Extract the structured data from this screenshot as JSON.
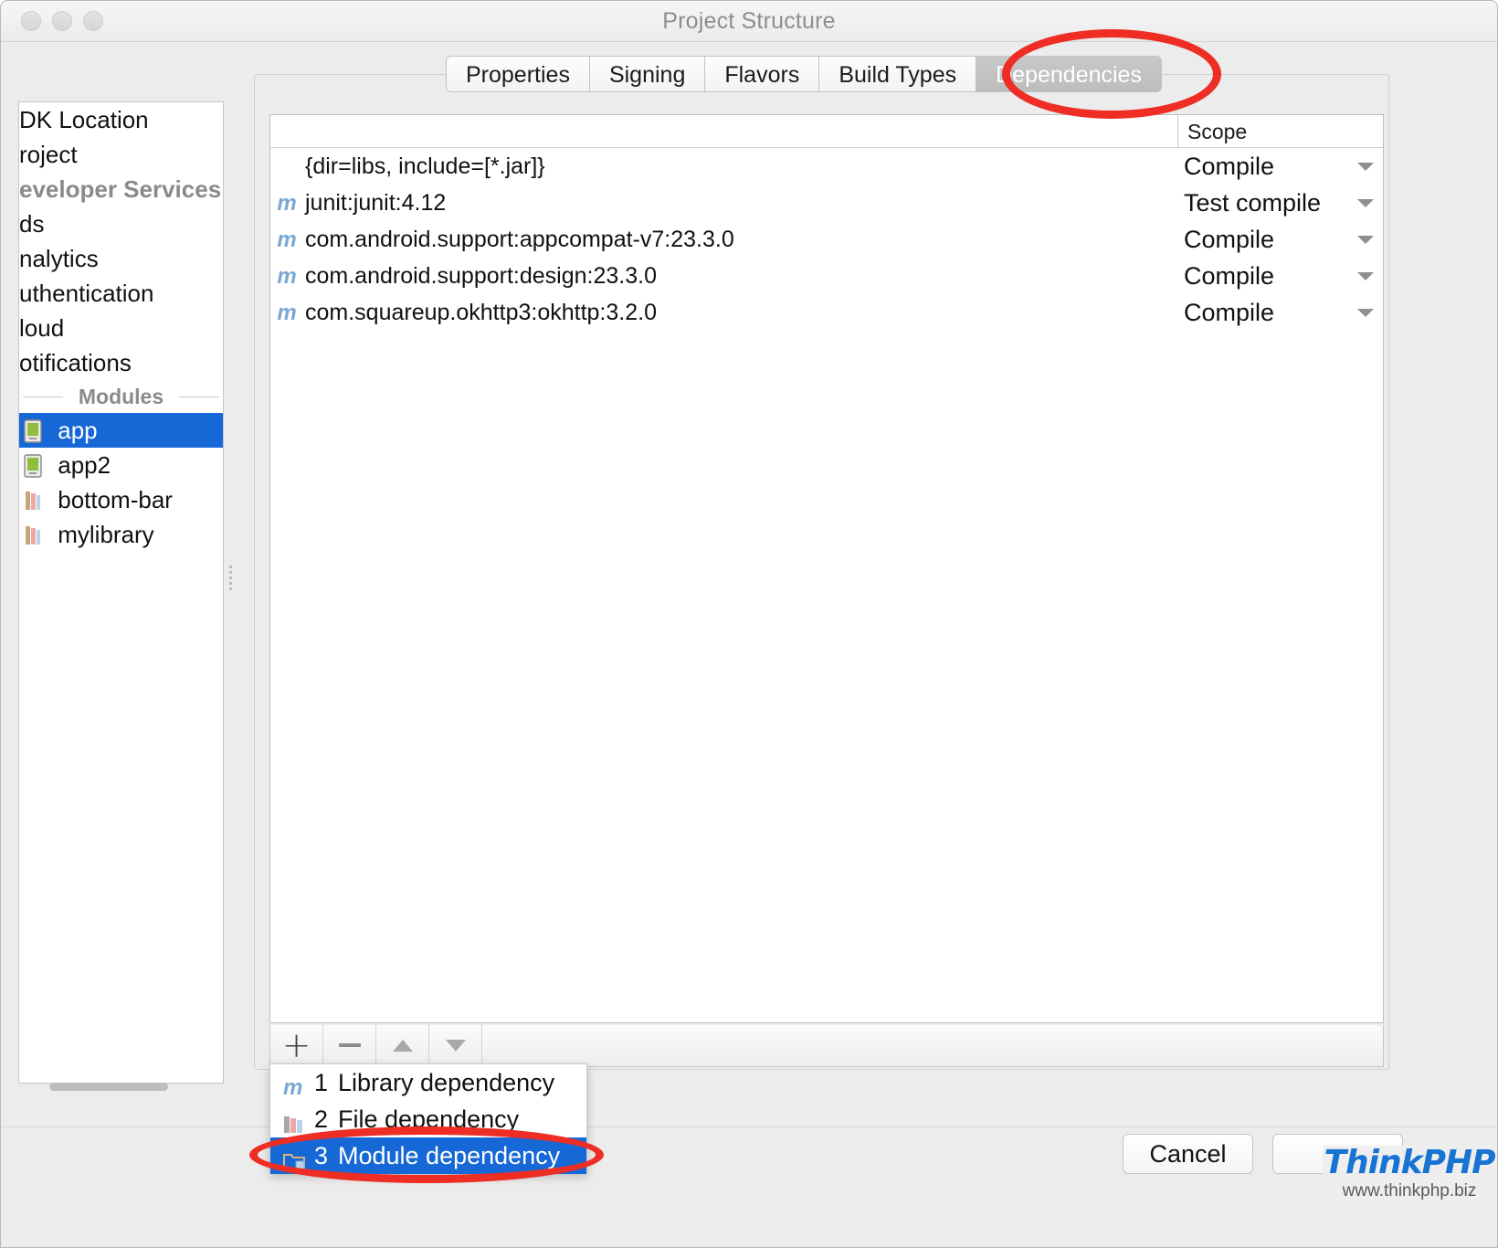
{
  "window": {
    "title": "Project Structure",
    "traffic_lights": [
      "close-button",
      "minimize-button",
      "zoom-button"
    ]
  },
  "sidebar": {
    "add_label": "+",
    "remove_label": "−",
    "items": [
      {
        "label": "DK Location",
        "type": "item",
        "icon": "",
        "selected": false
      },
      {
        "label": "roject",
        "type": "item",
        "icon": "",
        "selected": false
      },
      {
        "label": "eveloper Services",
        "type": "group-header",
        "icon": "",
        "selected": false
      },
      {
        "label": "ds",
        "type": "item",
        "icon": "",
        "selected": false
      },
      {
        "label": "nalytics",
        "type": "item",
        "icon": "",
        "selected": false
      },
      {
        "label": "uthentication",
        "type": "item",
        "icon": "",
        "selected": false
      },
      {
        "label": "loud",
        "type": "item",
        "icon": "",
        "selected": false
      },
      {
        "label": "otifications",
        "type": "item",
        "icon": "",
        "selected": false
      },
      {
        "label": "Modules",
        "type": "separator-header",
        "icon": "",
        "selected": false
      },
      {
        "label": "app",
        "type": "module",
        "icon": "android-module-icon",
        "selected": true
      },
      {
        "label": "app2",
        "type": "module",
        "icon": "android-module-icon",
        "selected": false
      },
      {
        "label": "bottom-bar",
        "type": "module",
        "icon": "library-module-icon",
        "selected": false
      },
      {
        "label": "mylibrary",
        "type": "module",
        "icon": "library-module-icon",
        "selected": false
      }
    ]
  },
  "tabs": [
    {
      "label": "Properties",
      "active": false
    },
    {
      "label": "Signing",
      "active": false
    },
    {
      "label": "Flavors",
      "active": false
    },
    {
      "label": "Build Types",
      "active": false
    },
    {
      "label": "Dependencies",
      "active": true
    }
  ],
  "dependencies_table": {
    "columns": [
      "",
      "Scope"
    ],
    "rows": [
      {
        "name": "{dir=libs, include=[*.jar]}",
        "icon": "",
        "scope": "Compile"
      },
      {
        "name": "junit:junit:4.12",
        "icon": "maven-icon",
        "scope": "Test compile"
      },
      {
        "name": "com.android.support:appcompat-v7:23.3.0",
        "icon": "maven-icon",
        "scope": "Compile"
      },
      {
        "name": "com.android.support:design:23.3.0",
        "icon": "maven-icon",
        "scope": "Compile"
      },
      {
        "name": "com.squareup.okhttp3:okhttp:3.2.0",
        "icon": "maven-icon",
        "scope": "Compile"
      }
    ]
  },
  "dep_toolbar": {
    "add": "+",
    "remove": "−",
    "move_up": "▲",
    "move_down": "▼"
  },
  "add_menu": {
    "items": [
      {
        "num": "1",
        "label": "Library dependency",
        "icon": "maven-icon",
        "selected": false
      },
      {
        "num": "2",
        "label": "File dependency",
        "icon": "file-jar-icon",
        "selected": false
      },
      {
        "num": "3",
        "label": "Module dependency",
        "icon": "module-folder-icon",
        "selected": true
      }
    ]
  },
  "footer": {
    "cancel_label": "Cancel",
    "ok_label": ""
  },
  "watermark": {
    "title": "ThinkPHP",
    "url": "www.thinkphp.biz"
  },
  "colors": {
    "selection_blue": "#1668d6",
    "annotation_red": "#ee2d24",
    "maven_icon_blue": "#7ba7d4",
    "watermark_blue": "#1874d2"
  }
}
